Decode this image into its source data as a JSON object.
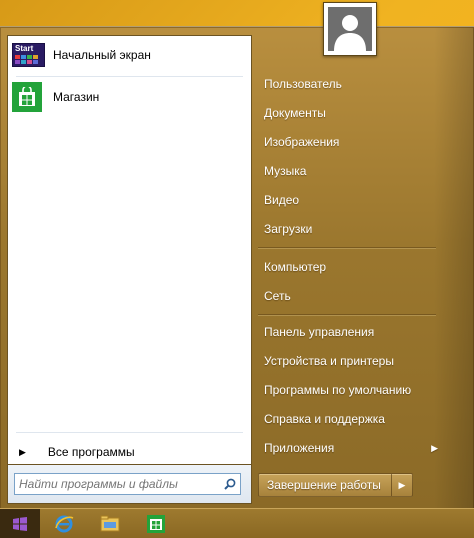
{
  "pinned": [
    {
      "label": "Начальный экран",
      "tile_text": "Start",
      "icon": "start-screen-icon"
    },
    {
      "label": "Магазин",
      "icon": "store-icon"
    }
  ],
  "all_programs": "Все программы",
  "search": {
    "placeholder": "Найти программы и файлы",
    "icon": "search-icon"
  },
  "right_menu": {
    "group1": [
      "Пользователь",
      "Документы",
      "Изображения",
      "Музыка",
      "Видео",
      "Загрузки"
    ],
    "group2": [
      "Компьютер",
      "Сеть"
    ],
    "group3": [
      "Панель управления",
      "Устройства и принтеры",
      "Программы по умолчанию",
      "Справка и поддержка",
      "Приложения"
    ]
  },
  "shutdown_label": "Завершение работы",
  "taskbar": {
    "items": [
      "windows-start-icon",
      "internet-explorer-icon",
      "file-explorer-icon",
      "store-icon"
    ]
  },
  "colors": {
    "menu": "#9b772e",
    "desktop": "#f0b321",
    "store_green": "#23a33a",
    "start_tile": "#2a1b63"
  }
}
